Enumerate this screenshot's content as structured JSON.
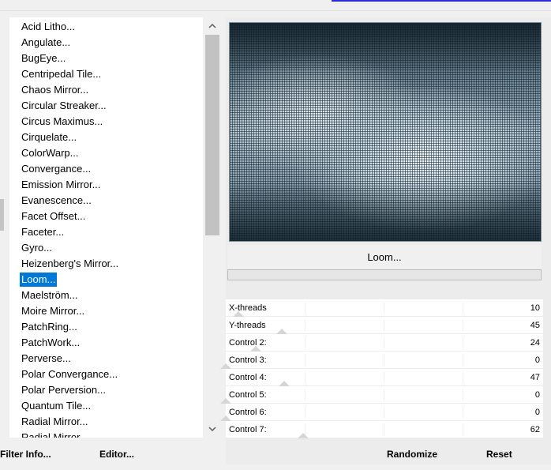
{
  "filters": {
    "items": [
      "Acid Litho...",
      "Angulate...",
      "BugEye...",
      "Centripedal Tile...",
      "Chaos Mirror...",
      "Circular Streaker...",
      "Circus Maximus...",
      "Cirquelate...",
      "ColorWarp...",
      "Convergance...",
      "Emission Mirror...",
      "Evanescence...",
      "Facet Offset...",
      "Faceter...",
      "Gyro...",
      "Heizenberg's Mirror...",
      "Loom...",
      "Maelström...",
      "Moire Mirror...",
      "PatchRing...",
      "PatchWork...",
      "Perverse...",
      "Polar Convergance...",
      "Polar Perversion...",
      "Quantum Tile...",
      "Radial Mirror...",
      "Radial Mirror..."
    ],
    "selected_index": 16
  },
  "buttons": {
    "filter_info": "Filter Info...",
    "editor": "Editor...",
    "randomize": "Randomize",
    "reset": "Reset"
  },
  "preview": {
    "filter_name": "Loom...",
    "progress": 0
  },
  "controls": [
    {
      "label": "X-threads",
      "value": "10",
      "max": 255
    },
    {
      "label": "Y-threads",
      "value": "45",
      "max": 255
    },
    {
      "label": "Control 2:",
      "value": "24",
      "max": 255
    },
    {
      "label": "Control 3:",
      "value": "0",
      "max": 255
    },
    {
      "label": "Control 4:",
      "value": "47",
      "max": 255
    },
    {
      "label": "Control 5:",
      "value": "0",
      "max": 255
    },
    {
      "label": "Control 6:",
      "value": "0",
      "max": 255
    },
    {
      "label": "Control 7:",
      "value": "62",
      "max": 255
    }
  ],
  "icons": {
    "scroll_up": "chevron-up-icon",
    "scroll_down": "chevron-down-icon"
  },
  "colors": {
    "selection": "#0078d7",
    "accent": "#2b2bd8"
  }
}
